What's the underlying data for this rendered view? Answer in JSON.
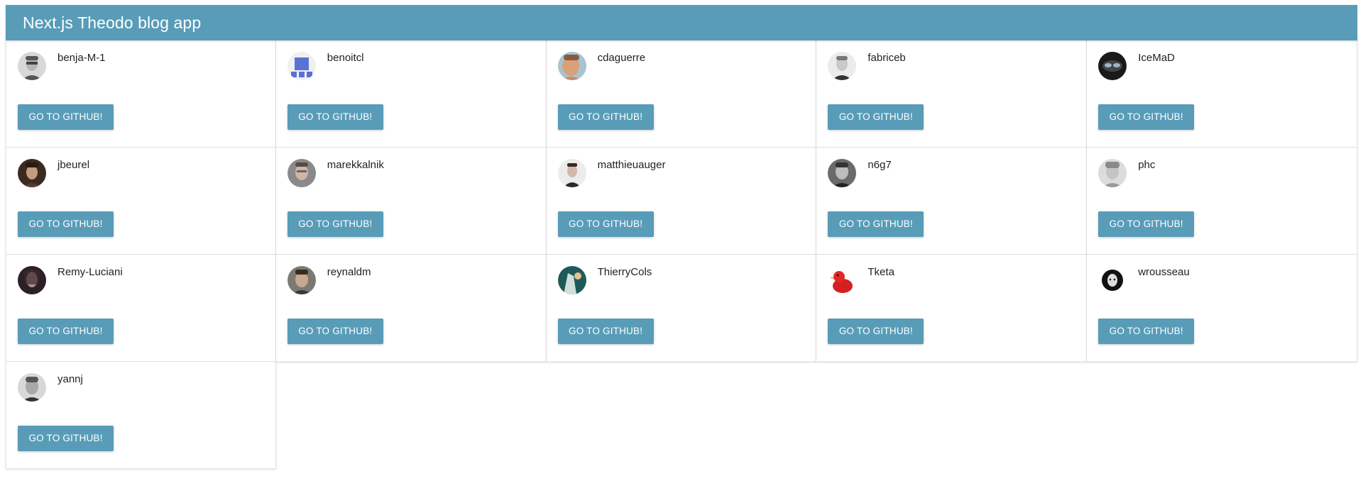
{
  "app_bar": {
    "title": "Next.js Theodo blog app",
    "color": "#589cb8"
  },
  "button_color": "#589cb8",
  "users": [
    {
      "username": "benja-M-1",
      "button_label": "GO TO GITHUB!",
      "avatar_icon": "avatar-icon"
    },
    {
      "username": "benoitcl",
      "button_label": "GO TO GITHUB!",
      "avatar_icon": "identicon-icon"
    },
    {
      "username": "cdaguerre",
      "button_label": "GO TO GITHUB!",
      "avatar_icon": "avatar-icon"
    },
    {
      "username": "fabriceb",
      "button_label": "GO TO GITHUB!",
      "avatar_icon": "avatar-icon"
    },
    {
      "username": "IceMaD",
      "button_label": "GO TO GITHUB!",
      "avatar_icon": "avatar-icon"
    },
    {
      "username": "jbeurel",
      "button_label": "GO TO GITHUB!",
      "avatar_icon": "avatar-icon"
    },
    {
      "username": "marekkalnik",
      "button_label": "GO TO GITHUB!",
      "avatar_icon": "avatar-icon"
    },
    {
      "username": "matthieuauger",
      "button_label": "GO TO GITHUB!",
      "avatar_icon": "avatar-icon"
    },
    {
      "username": "n6g7",
      "button_label": "GO TO GITHUB!",
      "avatar_icon": "avatar-icon"
    },
    {
      "username": "phc",
      "button_label": "GO TO GITHUB!",
      "avatar_icon": "avatar-icon"
    },
    {
      "username": "Remy-Luciani",
      "button_label": "GO TO GITHUB!",
      "avatar_icon": "avatar-icon"
    },
    {
      "username": "reynaldm",
      "button_label": "GO TO GITHUB!",
      "avatar_icon": "avatar-icon"
    },
    {
      "username": "ThierryCols",
      "button_label": "GO TO GITHUB!",
      "avatar_icon": "avatar-icon"
    },
    {
      "username": "Tketa",
      "button_label": "GO TO GITHUB!",
      "avatar_icon": "duck-icon"
    },
    {
      "username": "wrousseau",
      "button_label": "GO TO GITHUB!",
      "avatar_icon": "avatar-icon"
    },
    {
      "username": "yannj",
      "button_label": "GO TO GITHUB!",
      "avatar_icon": "avatar-icon"
    }
  ]
}
